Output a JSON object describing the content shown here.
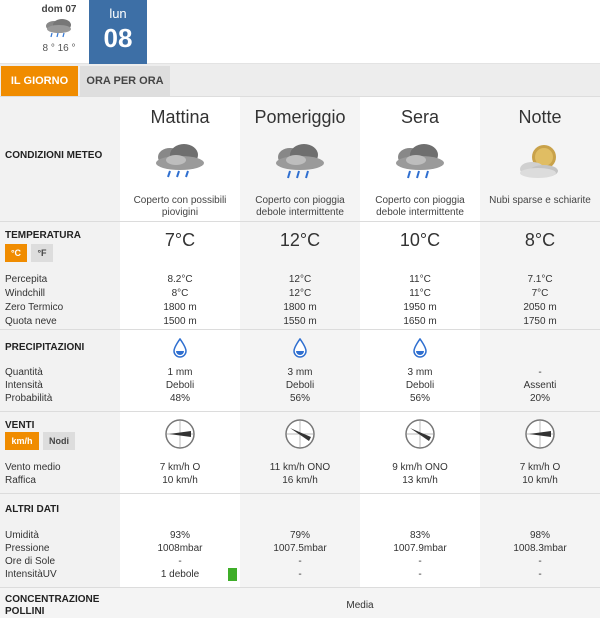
{
  "days": {
    "prev": {
      "name": "dom 07",
      "temps": "8 ° 16 °",
      "icon": "rain-cloud-icon"
    },
    "current": {
      "name": "lun",
      "number": "08"
    }
  },
  "tabs": {
    "day": "IL GIORNO",
    "hourly": "ORA PER ORA"
  },
  "periods": [
    "Mattina",
    "Pomeriggio",
    "Sera",
    "Notte"
  ],
  "conditions": {
    "label": "CONDIZIONI METEO",
    "items": [
      {
        "icon": "rain-cloud-icon",
        "desc1": "Coperto con possibili",
        "desc2": "piovigini"
      },
      {
        "icon": "rain-cloud-icon",
        "desc1": "Coperto con pioggia",
        "desc2": "debole intermittente"
      },
      {
        "icon": "rain-cloud-icon",
        "desc1": "Coperto con pioggia",
        "desc2": "debole intermittente"
      },
      {
        "icon": "moon-cloud-icon",
        "desc1": "Nubi sparse e schiarite",
        "desc2": ""
      }
    ]
  },
  "temperature": {
    "label": "TEMPERATURA",
    "unit_c": "°C",
    "unit_f": "°F",
    "values": [
      "7°C",
      "12°C",
      "10°C",
      "8°C"
    ],
    "rows": [
      {
        "label": "Percepita",
        "values": [
          "8.2°C",
          "12°C",
          "11°C",
          "7.1°C"
        ]
      },
      {
        "label": "Windchill",
        "values": [
          "8°C",
          "12°C",
          "11°C",
          "7°C"
        ]
      },
      {
        "label": "Zero Termico",
        "values": [
          "1800 m",
          "1800 m",
          "1950 m",
          "2050 m"
        ]
      },
      {
        "label": "Quota neve",
        "values": [
          "1500 m",
          "1550 m",
          "1650 m",
          "1750 m"
        ]
      }
    ]
  },
  "precipitation": {
    "label": "PRECIPITAZIONI",
    "icons": [
      "drop-icon",
      "drop-icon",
      "drop-icon",
      ""
    ],
    "nodrop": "-",
    "rows": [
      {
        "label": "Quantità",
        "values": [
          "1 mm",
          "3 mm",
          "3 mm",
          "-"
        ]
      },
      {
        "label": "Intensità",
        "values": [
          "Deboli",
          "Deboli",
          "Deboli",
          "Assenti"
        ]
      },
      {
        "label": "Probabilità",
        "values": [
          "48%",
          "56%",
          "56%",
          "20%"
        ]
      }
    ]
  },
  "wind": {
    "label": "VENTI",
    "unit_kmh": "km/h",
    "unit_knots": "Nodi",
    "compass_icons": [
      "compass-icon",
      "compass-icon",
      "compass-icon",
      "compass-icon"
    ],
    "rows": [
      {
        "label": "Vento medio",
        "values": [
          "7 km/h  O",
          "11 km/h ONO",
          "9 km/h ONO",
          "7 km/h  O"
        ]
      },
      {
        "label": "Raffica",
        "values": [
          "10 km/h",
          "16 km/h",
          "13 km/h",
          "10 km/h"
        ]
      }
    ]
  },
  "other": {
    "label": "ALTRI DATI",
    "rows": [
      {
        "label": "Umidità",
        "values": [
          "93%",
          "79%",
          "83%",
          "98%"
        ]
      },
      {
        "label": "Pressione",
        "values": [
          "1008mbar",
          "1007.5mbar",
          "1007.9mbar",
          "1008.3mbar"
        ]
      },
      {
        "label": "Ore di Sole",
        "values": [
          "-",
          "-",
          "-",
          "-"
        ]
      },
      {
        "label": "IntensitàUV",
        "values": [
          "1 debole",
          "-",
          "-",
          "-"
        ]
      }
    ],
    "uv_color": "#3fae29"
  },
  "pollen": {
    "label1": "CONCENTRAZIONE",
    "label2": "POLLINI",
    "value": "Media"
  },
  "colors": {
    "accent": "#f08c00",
    "current_day": "#3d6fa6"
  }
}
